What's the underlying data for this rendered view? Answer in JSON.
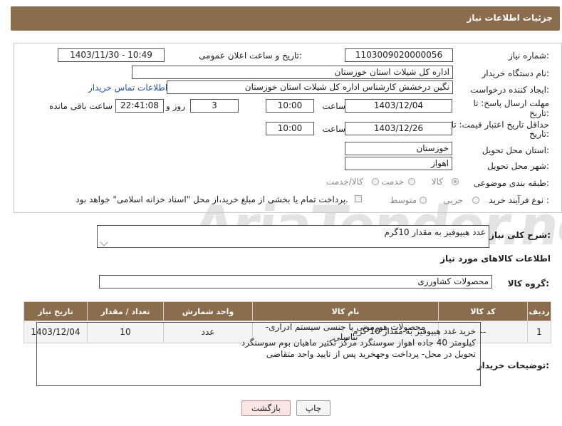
{
  "header": {
    "title": "جزئیات اطلاعات نیاز"
  },
  "watermark": {
    "text": "AriaTender.neT"
  },
  "form": {
    "need_number_label": "شماره نیاز:",
    "need_number": "1103009020000056",
    "announce_label": "تاریخ و ساعت اعلان عمومی:",
    "announce_value": "1403/11/30 - 10:49",
    "buyer_org_label": "نام دستگاه خریدار:",
    "buyer_org": "اداره کل شیلات استان خوزستان",
    "creator_label": "ایجاد کننده درخواست:",
    "creator": "نگین درخشش کارشناس اداره کل شیلات استان خوزستان",
    "contact_link": "اطلاعات تماس خریدار",
    "deadline_label_1": "مهلت ارسال پاسخ: تا",
    "deadline_label_2": "تاریخ:",
    "deadline_date": "1403/12/04",
    "time_label": "ساعت",
    "deadline_time": "10:00",
    "days_value": "3",
    "days_label": "روز و",
    "remaining_time": "22:41:08",
    "remaining_label": "ساعت باقی مانده",
    "validity_label_1": "حداقل تاریخ اعتبار قیمت: تا",
    "validity_label_2": "تاریخ:",
    "validity_date": "1403/12/26",
    "validity_time": "10:00",
    "province_label": "استان محل تحویل:",
    "province": "خوزستان",
    "city_label": "شهر محل تحویل:",
    "city": "اهواز",
    "category_label": "طبقه بندی موضوعی:",
    "category_options": [
      "کالا",
      "خدمت",
      "کالا/خدمت"
    ],
    "category_selected": "کالا",
    "process_label": "نوع فرآیند خرید :",
    "process_options": [
      "جزیی",
      "متوسط"
    ],
    "payment_note": "پرداخت تمام یا بخشی از مبلغ خرید،از محل \"اسناد خزانه اسلامی\" خواهد بود."
  },
  "description": {
    "label": "شرح کلی نیاز:",
    "value": "عدد هیپوفیز به مقدار 10گرم"
  },
  "goods_info": {
    "title": "اطلاعات کالاهای مورد نیاز",
    "group_label": "گروه کالا:",
    "group_value": "محصولات کشاورزی"
  },
  "table": {
    "headers": [
      "ردیف",
      "کد کالا",
      "نام کالا",
      "واحد شمارش",
      "تعداد / مقدار",
      "تاریخ نیاز"
    ],
    "rows": [
      [
        "1",
        "--",
        "محصولات هورمونی یا جنسی سیستم ادراری-تناسلی",
        "عدد",
        "10",
        "1403/12/04"
      ]
    ]
  },
  "notes": {
    "label": "توضیحات خریدار:",
    "lines": [
      "خرید غدد هیپوفیز به مقدار 10 گرم",
      "کیلومتر 40 جاده اهواز سوسنگرد مرکز تکثیر ماهیان بوم سوسنگرد",
      "تحویل در محل- پرداخت وجهخرید پس از تایید واحد متقاضی"
    ]
  },
  "buttons": {
    "print": "چاپ",
    "back": "بازگشت"
  }
}
